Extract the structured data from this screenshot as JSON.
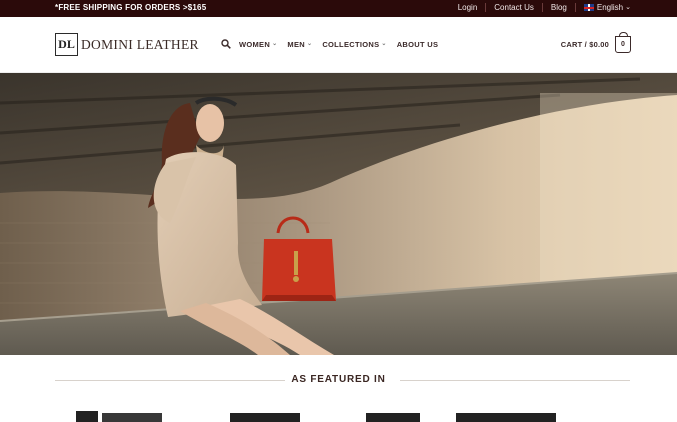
{
  "topbar": {
    "promo": "*FREE SHIPPING FOR ORDERS >$165",
    "links": {
      "login": "Login",
      "contact": "Contact Us",
      "blog": "Blog",
      "language": "English"
    }
  },
  "header": {
    "logo_mark": "DL",
    "logo_name": "DOMINI LEATHER",
    "nav": {
      "women": "WOMEN",
      "men": "MEN",
      "collections": "COLLECTIONS",
      "about": "ABOUT US"
    },
    "cart_label": "CART / $0.00",
    "cart_count": "0"
  },
  "featured": {
    "title": "AS FEATURED IN"
  },
  "colors": {
    "topbar": "#2b0a0a",
    "brand_text": "#3a2622",
    "bag_red": "#c9341f"
  }
}
